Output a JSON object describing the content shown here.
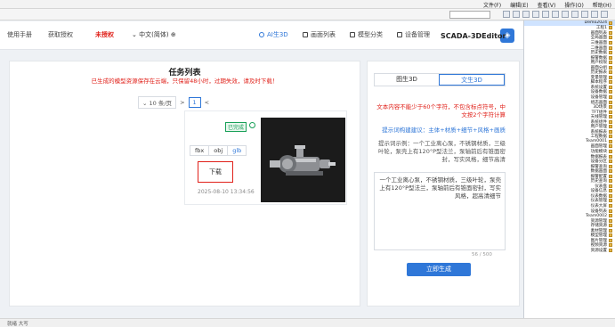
{
  "menubar": {
    "items": [
      "文件(F)",
      "编辑(E)",
      "查看(V)",
      "操作(O)",
      "帮助(H)"
    ],
    "search_value": ""
  },
  "header": {
    "app_name": "SCADA-3DEditor",
    "nav": [
      "设备管理",
      "模型分类",
      "画面列表",
      "AI生3D"
    ],
    "active_nav": "AI生3D",
    "language": "中文(简体)",
    "unauthorized": "未授权",
    "get_license": "获取授权",
    "manual": "使用手册"
  },
  "right_panel": {
    "tabs": [
      "文生3D",
      "图生3D"
    ],
    "active_tab": "文生3D",
    "red_note": "文本内容不能少于60个字符，不包含标点符号，中文按2个字符计算",
    "blue_note": "提示词构建建议：主体+材质+细节+风格+画质",
    "gray_note": "提示词示例：一个工业离心泵，不锈钢材质，三级叶轮，泵壳上有120°P型法兰，泵轴前后有锥面密封，写实风格，细节高清",
    "textarea_value": "一个工业离心泵，不锈钢材质，三级叶轮，泵壳上有120°P型法兰，泵轴前后有锥面密封，写实风格，超高清细节",
    "char_count": "56 / 500",
    "generate_button": "立即生成"
  },
  "left_panel": {
    "title": "任务列表",
    "subtitle": "已生成的模型资源保存在云端，只保留48小时，过期失效，请及时下载！",
    "pager": {
      "per_page": "10 条/页",
      "current_page": "1"
    },
    "card": {
      "status": "已完成",
      "formats": [
        "glb",
        "obj",
        "fbx"
      ],
      "active_format": "glb",
      "download_button": "下载",
      "timestamp": "2025-08-10 13:34:56"
    }
  },
  "tree": {
    "items": [
      "Demo2024",
      "工程1",
      "画面列表",
      "全局画面",
      "三维画面",
      "二维画面",
      "历史数据",
      "报警数据",
      "用户权限",
      "画面分组",
      "历史报表",
      "变量管理",
      "脚本程序",
      "系统设置",
      "设备数据",
      "设备管理",
      "组态画面",
      "3D场景",
      "TFT组件",
      "天线管理",
      "系统组件",
      "用户管理",
      "系统报表",
      "工程数据",
      "Team0001",
      "画面管理",
      "功能模块",
      "数据报表",
      "设备分区",
      "报警查询",
      "数据画面",
      "报警配置",
      "历史查询",
      "仪表盘",
      "设备信息",
      "仪表数据",
      "仪表管理",
      "仪表大屏",
      "设备列表",
      "Team0002",
      "资源管理",
      "存储资源",
      "素材管理",
      "模型管理",
      "图片管理",
      "视频资源",
      "资源设置"
    ],
    "selected": "Demo2024"
  },
  "statusbar": {
    "text": "就绪  大写"
  }
}
